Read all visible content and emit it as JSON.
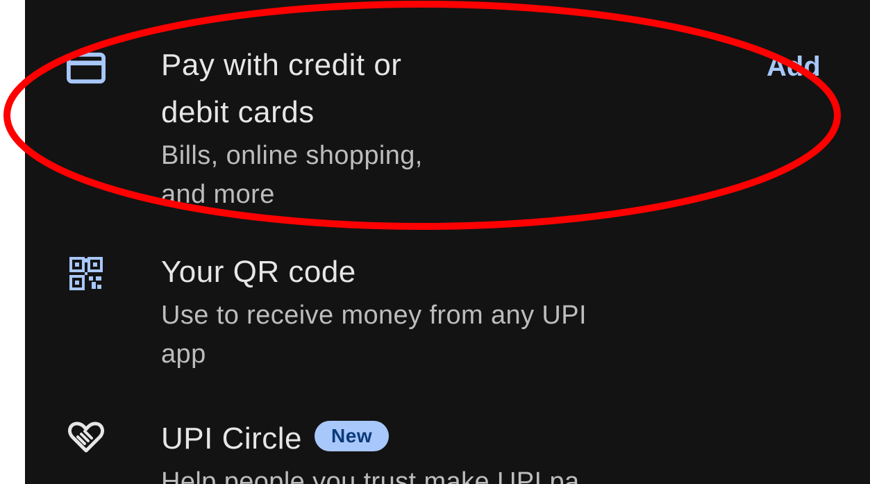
{
  "list": {
    "cards": {
      "title_line1": "Pay with credit or",
      "title_line2": "debit cards",
      "subtitle_line1": "Bills, online shopping,",
      "subtitle_line2": "and more",
      "action_label": "Add"
    },
    "qr": {
      "title": "Your QR code",
      "subtitle_line1": "Use to receive money from any UPI",
      "subtitle_line2": "app"
    },
    "upi_circle": {
      "title": "UPI Circle",
      "badge": "New",
      "subtitle": "Help people you trust make UPI pa..."
    }
  },
  "icons": {
    "cards": "credit-card-icon",
    "qr": "qr-code-icon",
    "upi_circle": "heart-handshake-icon"
  },
  "colors": {
    "background": "#131313",
    "title_text": "#e6e6e6",
    "subtitle_text": "#bdbdbd",
    "accent": "#a8c7fa",
    "badge_text": "#0b3a79",
    "annotation": "#ff0000"
  }
}
